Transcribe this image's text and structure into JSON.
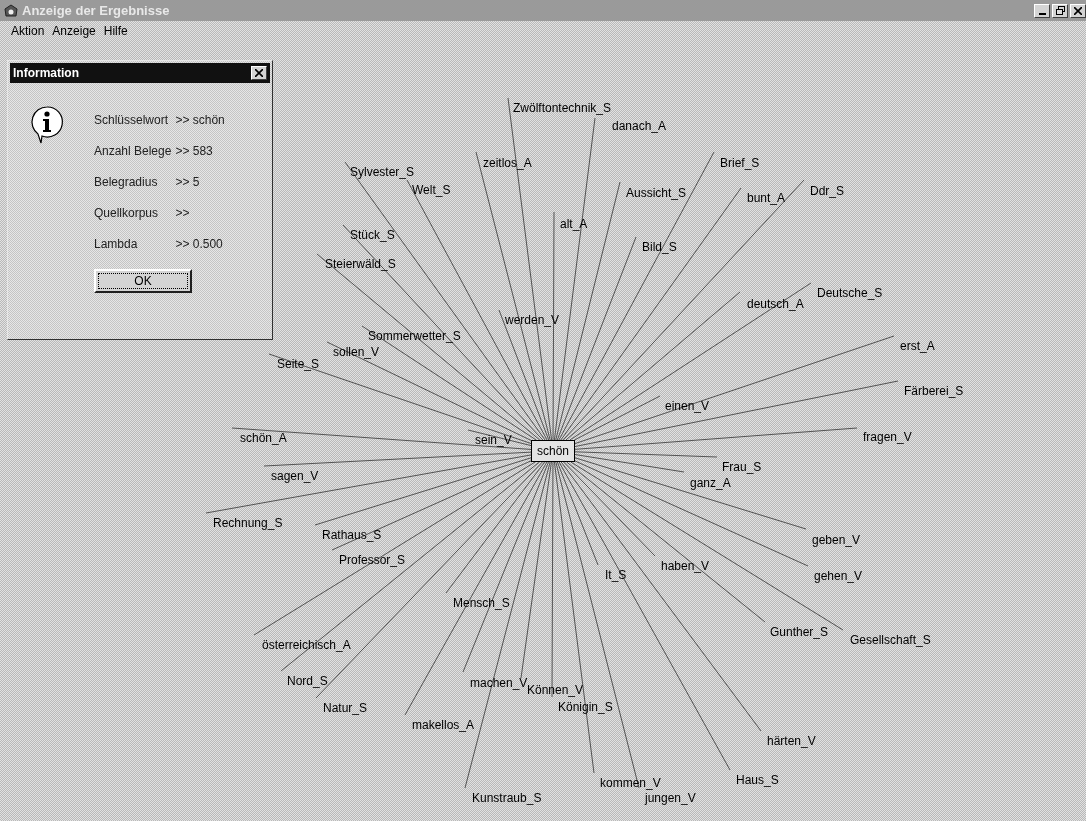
{
  "window": {
    "title": "Anzeige der Ergebnisse"
  },
  "menu": [
    {
      "label": "Aktion"
    },
    {
      "label": "Anzeige"
    },
    {
      "label": "Hilfe"
    }
  ],
  "graph": {
    "center": "schön",
    "nodes": [
      {
        "label": "Zwölftontechnik_S"
      },
      {
        "label": "danach_A"
      },
      {
        "label": "zeitlos_A"
      },
      {
        "label": "Sylvester_S"
      },
      {
        "label": "Welt_S"
      },
      {
        "label": "Brief_S"
      },
      {
        "label": "Aussicht_S"
      },
      {
        "label": "bunt_A"
      },
      {
        "label": "Ddr_S"
      },
      {
        "label": "alt_A"
      },
      {
        "label": "Stück_S"
      },
      {
        "label": "Bild_S"
      },
      {
        "label": "Steierwäld_S"
      },
      {
        "label": "deutsch_A"
      },
      {
        "label": "Deutsche_S"
      },
      {
        "label": "werden_V"
      },
      {
        "label": "Sommerwetter_S"
      },
      {
        "label": "sollen_V"
      },
      {
        "label": "Seite_S"
      },
      {
        "label": "erst_A"
      },
      {
        "label": "Färberei_S"
      },
      {
        "label": "einen_V"
      },
      {
        "label": "schön_A"
      },
      {
        "label": "sein_V"
      },
      {
        "label": "fragen_V"
      },
      {
        "label": "Frau_S"
      },
      {
        "label": "ganz_A"
      },
      {
        "label": "sagen_V"
      },
      {
        "label": "Rechnung_S"
      },
      {
        "label": "Rathaus_S"
      },
      {
        "label": "geben_V"
      },
      {
        "label": "Professor_S"
      },
      {
        "label": "It_S"
      },
      {
        "label": "haben_V"
      },
      {
        "label": "gehen_V"
      },
      {
        "label": "Mensch_S"
      },
      {
        "label": "Gunther_S"
      },
      {
        "label": "Gesellschaft_S"
      },
      {
        "label": "österreichisch_A"
      },
      {
        "label": "Nord_S"
      },
      {
        "label": "machen_V"
      },
      {
        "label": "Können_V"
      },
      {
        "label": "Natur_S"
      },
      {
        "label": "Königin_S"
      },
      {
        "label": "makellos_A"
      },
      {
        "label": "härten_V"
      },
      {
        "label": "Kunstraub_S"
      },
      {
        "label": "kommen_V"
      },
      {
        "label": "Haus_S"
      },
      {
        "label": "jungen_V"
      }
    ]
  },
  "dialog": {
    "title": "Information",
    "rows": [
      {
        "label": "Schlüsselwort",
        "value": ">> schön"
      },
      {
        "label": "Anzahl Belege",
        "value": ">> 583"
      },
      {
        "label": "Belegradius",
        "value": ">> 5"
      },
      {
        "label": "Quellkorpus",
        "value": ">>"
      },
      {
        "label": "Lambda",
        "value": ">> 0.500"
      }
    ],
    "button": "OK"
  }
}
